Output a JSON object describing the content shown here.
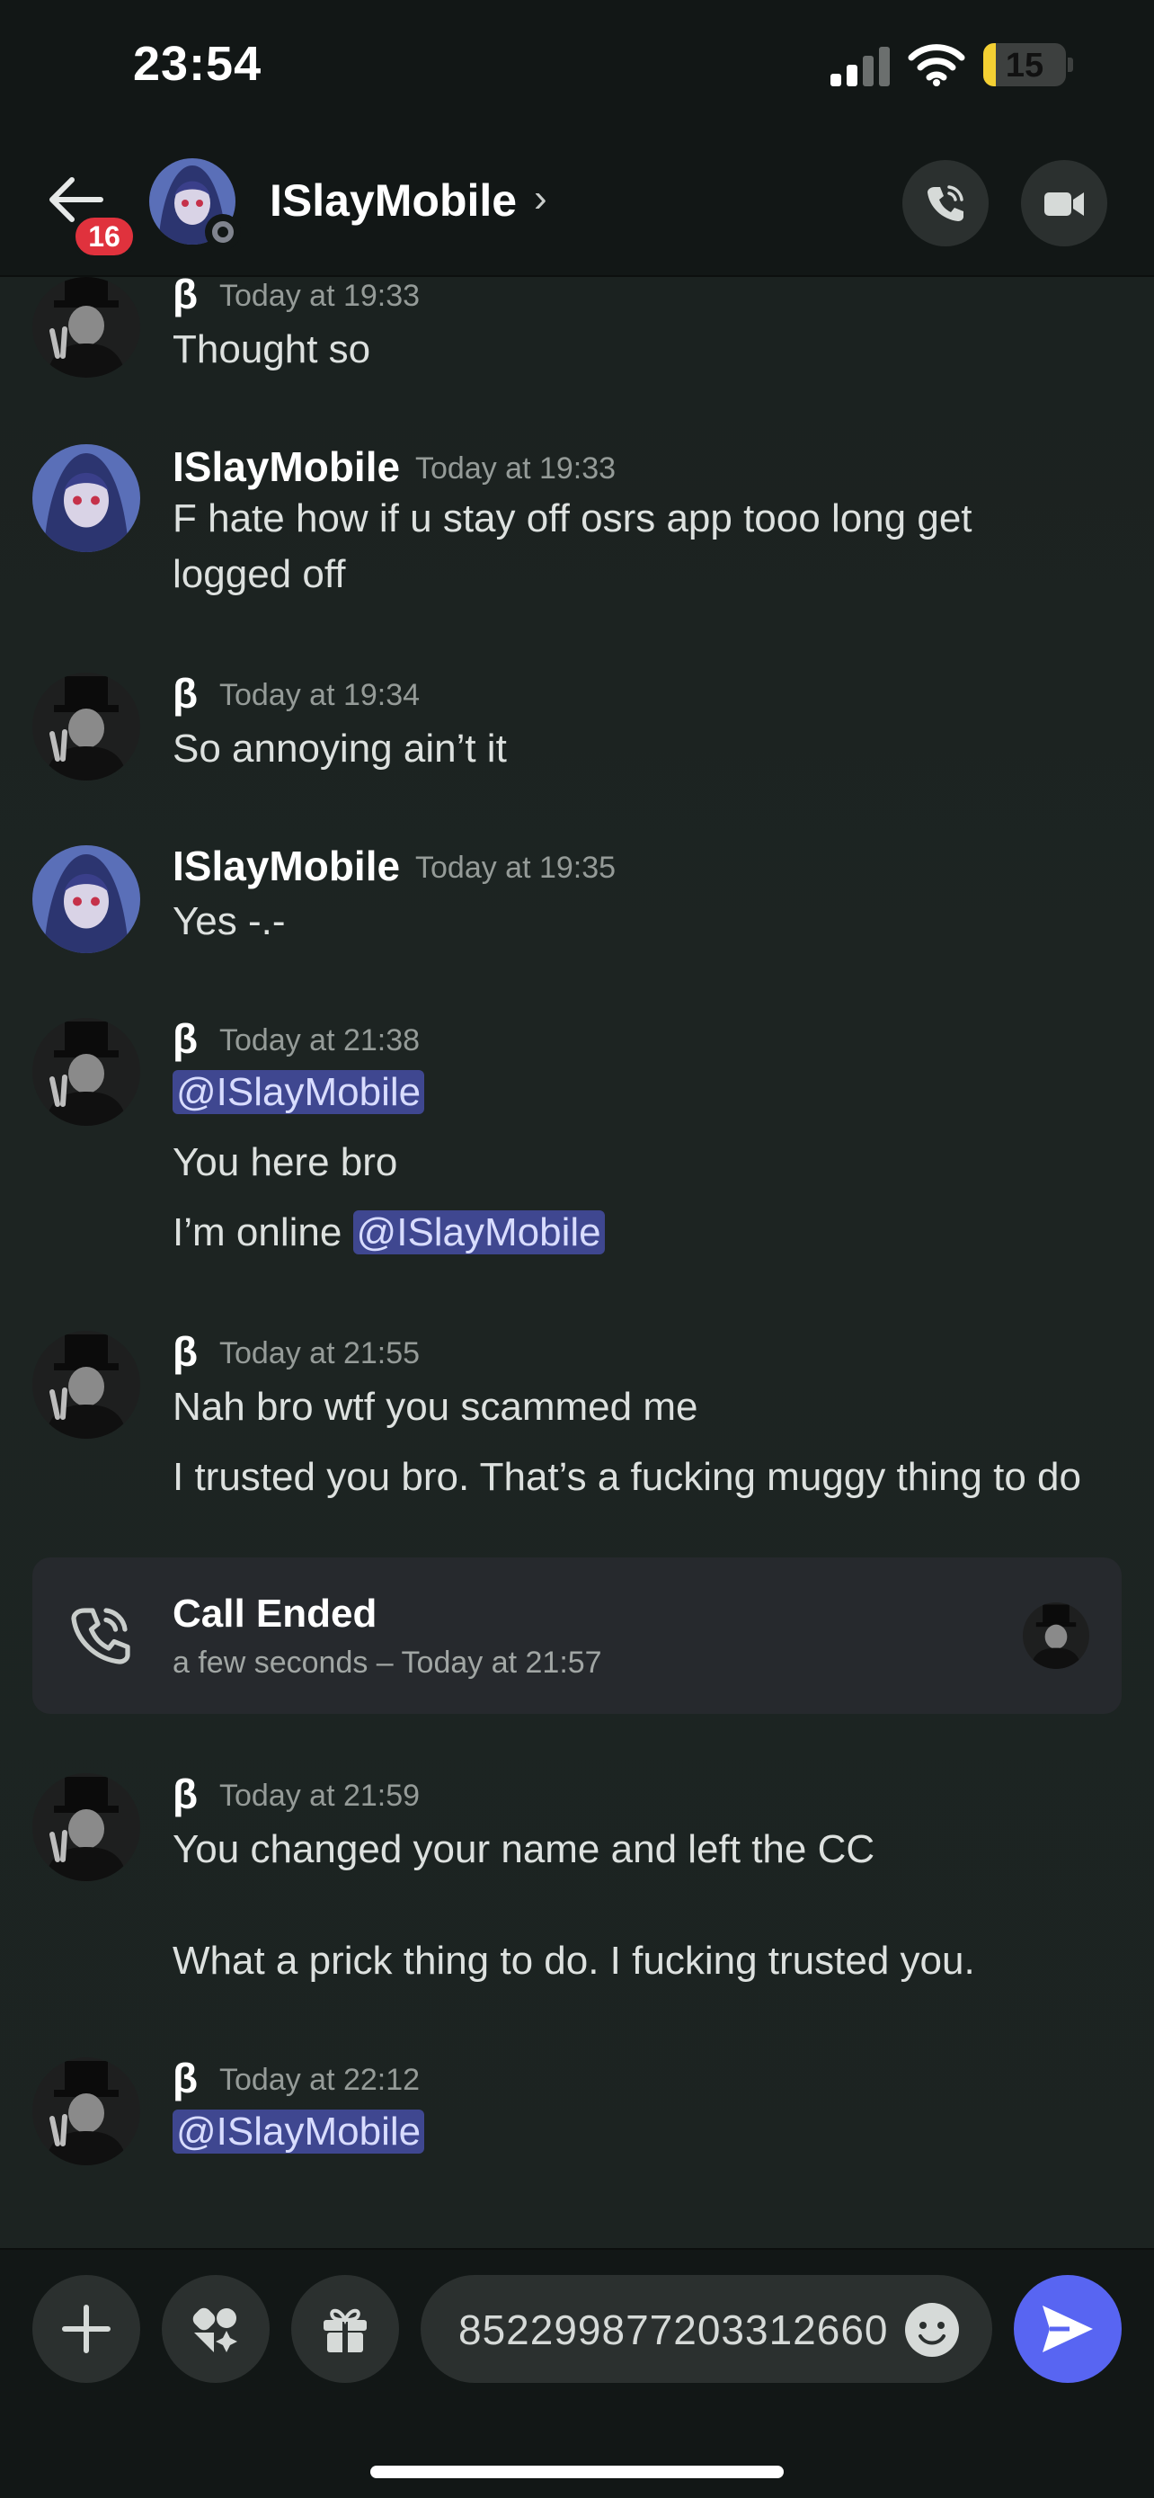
{
  "status_bar": {
    "time": "23:54",
    "battery": "15",
    "battery_level_percent": 15
  },
  "header": {
    "back_badge": "16",
    "contact_name": "ISlayMobile",
    "chevron": "›",
    "icons": {
      "back": "arrow-left-icon",
      "call": "phone-call-icon",
      "video": "video-camera-icon",
      "status": "offline-status-icon"
    }
  },
  "messages": [
    {
      "author": "β",
      "timestamp": "Today at 19:33",
      "lines": [
        "Thought so"
      ]
    },
    {
      "author": "ISlayMobile",
      "timestamp": "Today at 19:33",
      "lines": [
        "F hate how if u stay off osrs app tooo long get",
        "logged off"
      ]
    },
    {
      "author": "β",
      "timestamp": "Today at 19:34",
      "lines": [
        "So annoying ain’t it"
      ]
    },
    {
      "author": "ISlayMobile",
      "timestamp": "Today at 19:35",
      "lines": [
        "Yes -.-"
      ]
    },
    {
      "author": "β",
      "timestamp": "Today at 21:38",
      "mention": "@ISlayMobile",
      "lines": [
        "You here bro",
        "I’m online"
      ],
      "trailing_mention": "@ISlayMobile"
    },
    {
      "author": "β",
      "timestamp": "Today at 21:55",
      "lines": [
        "Nah bro wtf you scammed me",
        "I trusted you bro. That’s a fucking muggy thing to do"
      ]
    },
    {
      "author": "β",
      "timestamp": "Today at 21:59",
      "lines": [
        "You changed your name and left the CC",
        "What a prick thing to do. I fucking trusted you."
      ]
    },
    {
      "author": "β",
      "timestamp": "Today at 22:12",
      "mention": "@ISlayMobile"
    }
  ],
  "call": {
    "title": "Call Ended",
    "subtitle": "a few seconds – Today at 21:57",
    "icon": "phone-icon"
  },
  "composer": {
    "value": "852299877203312660",
    "icons": {
      "add": "plus-icon",
      "apps": "apps-icon",
      "gift": "gift-icon",
      "emoji": "emoji-icon",
      "send": "send-icon"
    }
  },
  "colors": {
    "accent": "#5865f2",
    "badge": "#e0323d",
    "mention_bg": "#3f4790"
  }
}
